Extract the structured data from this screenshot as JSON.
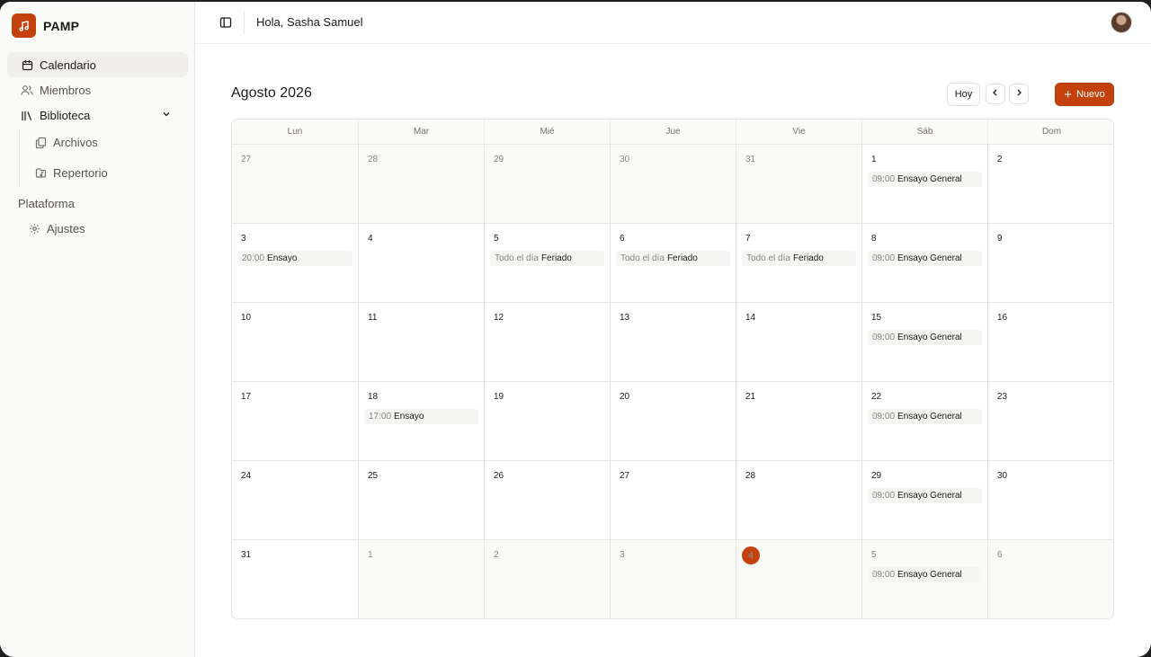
{
  "brand": {
    "name": "PAMP",
    "accent": "#c2410c"
  },
  "sidebar": {
    "items": [
      {
        "label": "Calendario",
        "icon": "calendar-icon",
        "active": true
      },
      {
        "label": "Miembros",
        "icon": "users-icon"
      },
      {
        "label": "Biblioteca",
        "icon": "library-icon",
        "expanded": true
      },
      {
        "label": "Archivos",
        "icon": "files-icon",
        "sub": true
      },
      {
        "label": "Repertorio",
        "icon": "folder-music-icon",
        "sub": true
      }
    ],
    "section_label": "Plataforma",
    "settings_label": "Ajustes"
  },
  "header": {
    "greeting": "Hola, Sasha Samuel"
  },
  "calendar": {
    "title": "Agosto 2026",
    "today_label": "Hoy",
    "new_label": "Nuevo",
    "weekdays": [
      "Lun",
      "Mar",
      "Mié",
      "Jue",
      "Vie",
      "Sáb",
      "Dom"
    ],
    "days": [
      {
        "d": "27",
        "out": true
      },
      {
        "d": "28",
        "out": true
      },
      {
        "d": "29",
        "out": true
      },
      {
        "d": "30",
        "out": true
      },
      {
        "d": "31",
        "out": true
      },
      {
        "d": "1",
        "events": [
          {
            "time": "09:00",
            "title": "Ensayo General"
          }
        ]
      },
      {
        "d": "2"
      },
      {
        "d": "3",
        "events": [
          {
            "time": "20:00",
            "title": "Ensayo"
          }
        ]
      },
      {
        "d": "4"
      },
      {
        "d": "5",
        "events": [
          {
            "time": "Todo el día",
            "title": "Feriado"
          }
        ]
      },
      {
        "d": "6",
        "events": [
          {
            "time": "Todo el día",
            "title": "Feriado"
          }
        ]
      },
      {
        "d": "7",
        "events": [
          {
            "time": "Todo el día",
            "title": "Feriado"
          }
        ]
      },
      {
        "d": "8",
        "events": [
          {
            "time": "09:00",
            "title": "Ensayo General"
          }
        ]
      },
      {
        "d": "9"
      },
      {
        "d": "10"
      },
      {
        "d": "11"
      },
      {
        "d": "12"
      },
      {
        "d": "13"
      },
      {
        "d": "14"
      },
      {
        "d": "15",
        "events": [
          {
            "time": "09:00",
            "title": "Ensayo General"
          }
        ]
      },
      {
        "d": "16"
      },
      {
        "d": "17"
      },
      {
        "d": "18",
        "events": [
          {
            "time": "17:00",
            "title": "Ensayo"
          }
        ]
      },
      {
        "d": "19"
      },
      {
        "d": "20"
      },
      {
        "d": "21"
      },
      {
        "d": "22",
        "events": [
          {
            "time": "09:00",
            "title": "Ensayo General"
          }
        ]
      },
      {
        "d": "23"
      },
      {
        "d": "24"
      },
      {
        "d": "25"
      },
      {
        "d": "26"
      },
      {
        "d": "27"
      },
      {
        "d": "28"
      },
      {
        "d": "29",
        "events": [
          {
            "time": "09:00",
            "title": "Ensayo General"
          }
        ]
      },
      {
        "d": "30"
      },
      {
        "d": "31"
      },
      {
        "d": "1",
        "out": true
      },
      {
        "d": "2",
        "out": true
      },
      {
        "d": "3",
        "out": true
      },
      {
        "d": "4",
        "out": true,
        "today": true
      },
      {
        "d": "5",
        "out": true,
        "events": [
          {
            "time": "09:00",
            "title": "Ensayo General"
          }
        ]
      },
      {
        "d": "6",
        "out": true
      }
    ]
  }
}
